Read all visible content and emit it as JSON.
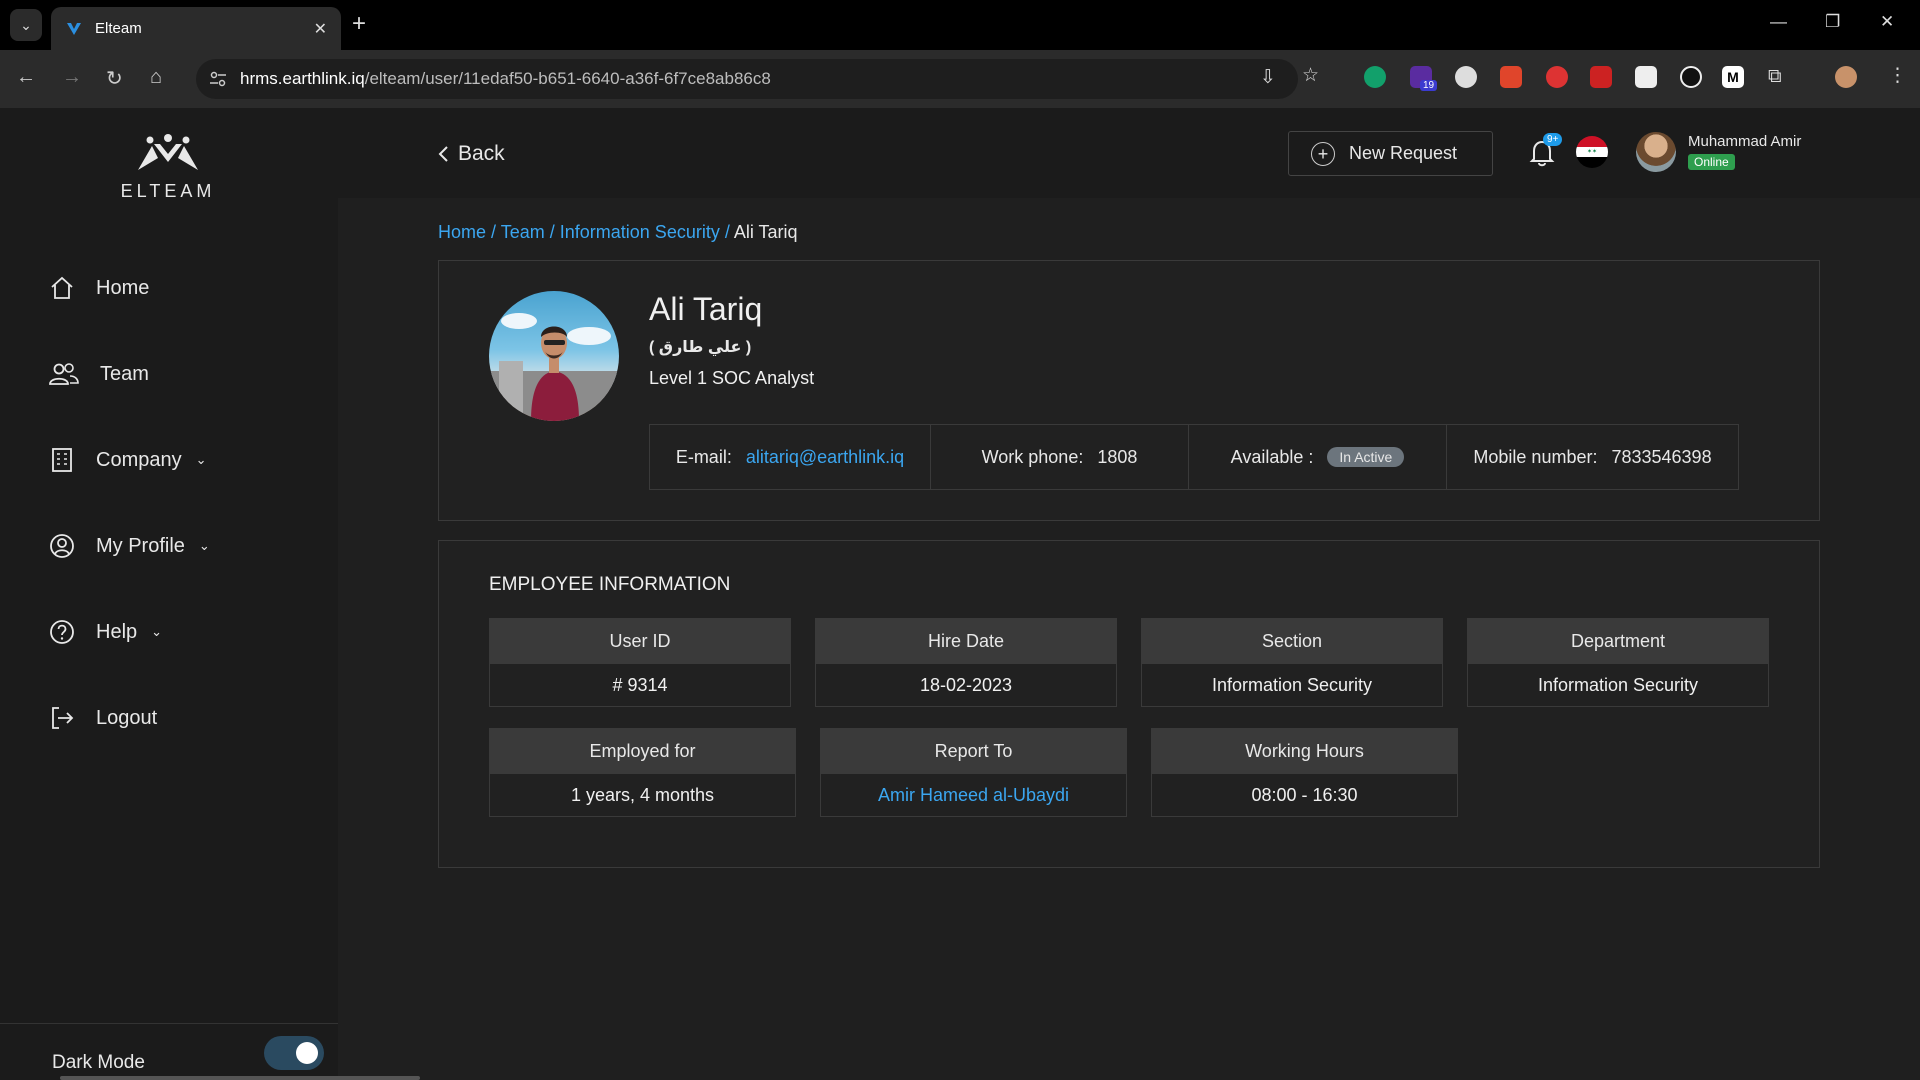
{
  "browser": {
    "tab_title": "Elteam",
    "url_host": "hrms.earthlink.iq",
    "url_path": "/elteam/user/11edaf50-b651-6640-a36f-6f7ce8ab86c8",
    "ext_badge": "19"
  },
  "app": {
    "logo_text": "ELTEAM",
    "nav": [
      {
        "label": "Home",
        "icon": "home-icon"
      },
      {
        "label": "Team",
        "icon": "team-icon"
      },
      {
        "label": "Company",
        "icon": "building-icon"
      },
      {
        "label": "My Profile",
        "icon": "profile-icon"
      },
      {
        "label": "Help",
        "icon": "help-icon"
      },
      {
        "label": "Logout",
        "icon": "logout-icon"
      }
    ],
    "dark_mode_label": "Dark Mode",
    "dark_mode_on": true
  },
  "topbar": {
    "back_label": "Back",
    "new_request_label": "New Request",
    "notification_badge": "9+",
    "user_name": "Muhammad Amir",
    "user_status": "Online"
  },
  "breadcrumb": {
    "home": "Home /",
    "team": "Team /",
    "section": "Information Security /",
    "current": "Ali Tariq"
  },
  "profile": {
    "name": "Ali Tariq",
    "arabic_name": "( علي طارق )",
    "job_title": "Level 1 SOC Analyst",
    "email_label": "E-mail:",
    "email": "alitariq@earthlink.iq",
    "work_phone_label": "Work phone:",
    "work_phone": "1808",
    "available_label": "Available :",
    "available_status": "In Active",
    "mobile_label": "Mobile number:",
    "mobile": "7833546398"
  },
  "employee_info": {
    "title": "EMPLOYEE INFORMATION",
    "user_id_label": "User ID",
    "user_id": "# 9314",
    "hire_date_label": "Hire Date",
    "hire_date": "18-02-2023",
    "section_label": "Section",
    "section": "Information Security",
    "department_label": "Department",
    "department": "Information Security",
    "employed_for_label": "Employed for",
    "employed_for": "1 years, 4 months",
    "report_to_label": "Report To",
    "report_to": "Amir Hameed al-Ubaydi",
    "working_hours_label": "Working Hours",
    "working_hours": "08:00 - 16:30"
  }
}
